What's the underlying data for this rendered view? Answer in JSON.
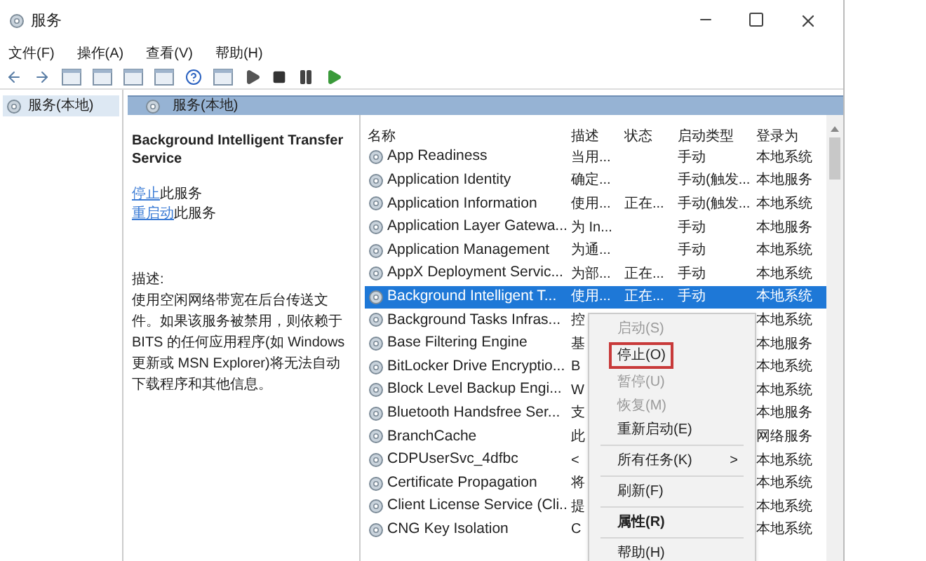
{
  "window": {
    "title": "服务"
  },
  "menu_bar": [
    "文件(F)",
    "操作(A)",
    "查看(V)",
    "帮助(H)"
  ],
  "tree": {
    "items": [
      {
        "label": "服务(本地)",
        "selected": true
      }
    ]
  },
  "panel": {
    "title": "服务(本地)"
  },
  "details": {
    "service_name": "Background Intelligent Transfer Service",
    "actions": [
      {
        "link": "停止",
        "rest": "此服务"
      },
      {
        "link": "重启动",
        "rest": "此服务"
      }
    ],
    "description_label": "描述:",
    "description": "使用空闲网络带宽在后台传送文件。如果该服务被禁用，则依赖于 BITS 的任何应用程序(如 Windows 更新或 MSN Explorer)将无法自动下载程序和其他信息。"
  },
  "table": {
    "columns": [
      "名称",
      "描述",
      "状态",
      "启动类型",
      "登录为"
    ],
    "rows": [
      {
        "name": "App Readiness",
        "description": "当用...",
        "status": "",
        "startup": "手动",
        "logon": "本地系统",
        "selected": false
      },
      {
        "name": "Application Identity",
        "description": "确定...",
        "status": "",
        "startup": "手动(触发...",
        "logon": "本地服务",
        "selected": false
      },
      {
        "name": "Application Information",
        "description": "使用...",
        "status": "正在...",
        "startup": "手动(触发...",
        "logon": "本地系统",
        "selected": false
      },
      {
        "name": "Application Layer Gatewa...",
        "description": "为 In...",
        "status": "",
        "startup": "手动",
        "logon": "本地服务",
        "selected": false
      },
      {
        "name": "Application Management",
        "description": "为通...",
        "status": "",
        "startup": "手动",
        "logon": "本地系统",
        "selected": false
      },
      {
        "name": "AppX Deployment Servic...",
        "description": "为部...",
        "status": "正在...",
        "startup": "手动",
        "logon": "本地系统",
        "selected": false
      },
      {
        "name": "Background Intelligent T...",
        "description": "使用...",
        "status": "正在...",
        "startup": "手动",
        "logon": "本地系统",
        "selected": true
      },
      {
        "name": "Background Tasks Infras...",
        "description": "控",
        "status": "",
        "startup": "",
        "logon": "本地系统",
        "selected": false
      },
      {
        "name": "Base Filtering Engine",
        "description": "基",
        "status": "",
        "startup": "",
        "logon": "本地服务",
        "selected": false
      },
      {
        "name": "BitLocker Drive Encryptio...",
        "description": "B",
        "status": "",
        "startup": "",
        "logon": "本地系统",
        "selected": false
      },
      {
        "name": "Block Level Backup Engi...",
        "description": "W",
        "status": "",
        "startup": "",
        "logon": "本地系统",
        "selected": false
      },
      {
        "name": "Bluetooth Handsfree Ser...",
        "description": "支",
        "status": "",
        "startup": "",
        "logon": "本地服务",
        "selected": false
      },
      {
        "name": "BranchCache",
        "description": "此",
        "status": "",
        "startup": "",
        "logon": "网络服务",
        "selected": false
      },
      {
        "name": "CDPUserSvc_4dfbc",
        "description": "<",
        "status": "",
        "startup": "",
        "logon": "本地系统",
        "selected": false
      },
      {
        "name": "Certificate Propagation",
        "description": "将",
        "status": "",
        "startup": "",
        "logon": "本地系统",
        "selected": false
      },
      {
        "name": "Client License Service (Cli...",
        "description": "提",
        "status": "",
        "startup": "",
        "logon": "本地系统",
        "selected": false
      },
      {
        "name": "CNG Key Isolation",
        "description": "C",
        "status": "",
        "startup": "",
        "logon": "本地系统",
        "selected": false
      }
    ]
  },
  "context_menu": {
    "items": [
      {
        "kind": "item",
        "label": "启动(S)",
        "disabled": true,
        "highlighted": false
      },
      {
        "kind": "item",
        "label": "停止(O)",
        "disabled": false,
        "highlighted": true
      },
      {
        "kind": "item",
        "label": "暂停(U)",
        "disabled": true,
        "highlighted": false
      },
      {
        "kind": "item",
        "label": "恢复(M)",
        "disabled": true,
        "highlighted": false
      },
      {
        "kind": "item",
        "label": "重新启动(E)",
        "disabled": false,
        "highlighted": false
      },
      {
        "kind": "separator"
      },
      {
        "kind": "submenu",
        "label": "所有任务(K)",
        "arrow": ">",
        "disabled": false,
        "highlighted": false
      },
      {
        "kind": "separator"
      },
      {
        "kind": "item",
        "label": "刷新(F)",
        "disabled": false,
        "highlighted": false
      },
      {
        "kind": "separator"
      },
      {
        "kind": "default",
        "label": "属性(R)",
        "disabled": false,
        "highlighted": false
      },
      {
        "kind": "separator"
      },
      {
        "kind": "item",
        "label": "帮助(H)",
        "disabled": false,
        "highlighted": false
      }
    ]
  }
}
